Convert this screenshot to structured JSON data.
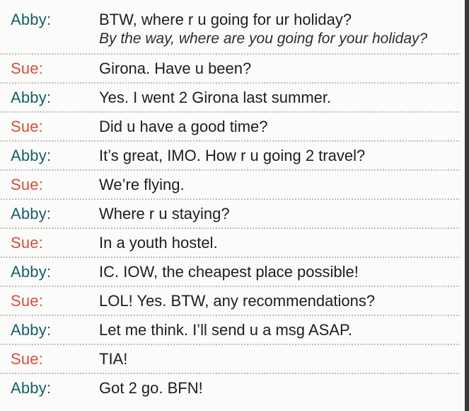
{
  "dialogue": [
    {
      "speaker": "Abby:",
      "role": "abby",
      "text": "BTW, where r u going for ur holiday?",
      "translation": "By the way, where are you going for your holiday?"
    },
    {
      "speaker": "Sue:",
      "role": "sue",
      "text": "Girona. Have u been?"
    },
    {
      "speaker": "Abby:",
      "role": "abby",
      "text": "Yes. I went 2 Girona last summer."
    },
    {
      "speaker": "Sue:",
      "role": "sue",
      "text": "Did u have a good time?"
    },
    {
      "speaker": "Abby:",
      "role": "abby",
      "text": "It’s great, IMO. How r u going 2 travel?"
    },
    {
      "speaker": "Sue:",
      "role": "sue",
      "text": "We’re flying."
    },
    {
      "speaker": "Abby:",
      "role": "abby",
      "text": "Where r u staying?"
    },
    {
      "speaker": "Sue:",
      "role": "sue",
      "text": "In a youth hostel."
    },
    {
      "speaker": "Abby:",
      "role": "abby",
      "text": "IC. IOW, the cheapest place possible!"
    },
    {
      "speaker": "Sue:",
      "role": "sue",
      "text": "LOL! Yes. BTW, any recommendations?"
    },
    {
      "speaker": "Abby:",
      "role": "abby",
      "text": "Let me think. I’ll send u a msg ASAP."
    },
    {
      "speaker": "Sue:",
      "role": "sue",
      "text": "TIA!"
    },
    {
      "speaker": "Abby:",
      "role": "abby",
      "text": "Got 2 go. BFN!"
    }
  ],
  "colors": {
    "abby": "#145f67",
    "sue": "#d2503a",
    "text": "#1e1e1e",
    "divider": "#b9b9b9"
  }
}
